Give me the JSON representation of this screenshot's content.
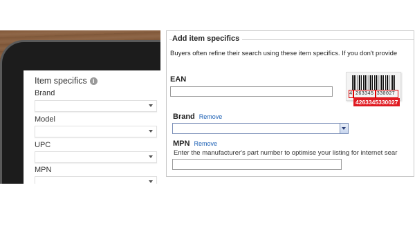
{
  "left": {
    "title": "Item specifics",
    "info_icon": "i",
    "fields": [
      {
        "label": "Brand"
      },
      {
        "label": "Model"
      },
      {
        "label": "UPC"
      },
      {
        "label": "MPN"
      }
    ]
  },
  "right": {
    "legend": "Add item specifics",
    "intro": "Buyers often refine their search using these item specifics. If you don't provide",
    "ean_label": "EAN",
    "barcode": {
      "digit_lead": "4",
      "digit_group1": "263345",
      "digit_group2": "330027",
      "ean_value": "4263345330027"
    },
    "brand_label": "Brand",
    "brand_remove": "Remove",
    "mpn_label": "MPN",
    "mpn_remove": "Remove",
    "mpn_desc": "Enter the manufacturer's part number to optimise your listing for internet sear"
  },
  "colors": {
    "link": "#1a5fb4",
    "ean_badge": "#e01b22",
    "wood": "#7a5436"
  }
}
